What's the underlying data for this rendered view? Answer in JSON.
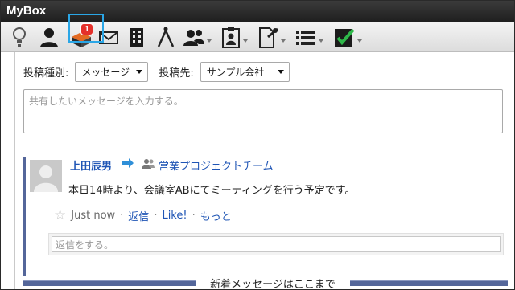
{
  "window": {
    "title": "MyBox"
  },
  "toolbar": {
    "items": [
      {
        "icon": "lightbulb-icon"
      },
      {
        "icon": "person-icon"
      },
      {
        "icon": "message-box-icon",
        "badge": "1",
        "selected": true
      },
      {
        "icon": "mail-icon"
      },
      {
        "icon": "building-icon"
      },
      {
        "icon": "compass-icon"
      },
      {
        "icon": "group-icon",
        "dropdown": true
      },
      {
        "icon": "clipboard-user-icon",
        "dropdown": true
      },
      {
        "icon": "document-pin-icon",
        "dropdown": true
      },
      {
        "icon": "list-icon",
        "dropdown": true
      },
      {
        "icon": "checkbox-check-icon",
        "dropdown": true
      }
    ],
    "badge_count": "1"
  },
  "composer": {
    "type_label": "投稿種別:",
    "type_value": "メッセージ",
    "target_label": "投稿先:",
    "target_value": "サンプル会社",
    "placeholder": "共有したいメッセージを入力する。"
  },
  "post": {
    "author": "上田辰男",
    "team": "営業プロジェクトチーム",
    "message": "本日14時より、会議室ABにてミーティングを行う予定です。",
    "time": "Just now",
    "actions": {
      "reply": "返信",
      "like": "Like!",
      "more": "もっと"
    },
    "reply_placeholder": "返信をする。"
  },
  "divider": {
    "text": "新着メッセージはここまで"
  },
  "colors": {
    "accent": "#1f55b5",
    "highlight": "#2aa6e6",
    "badge": "#e4302a",
    "post_bar": "#54669a"
  }
}
